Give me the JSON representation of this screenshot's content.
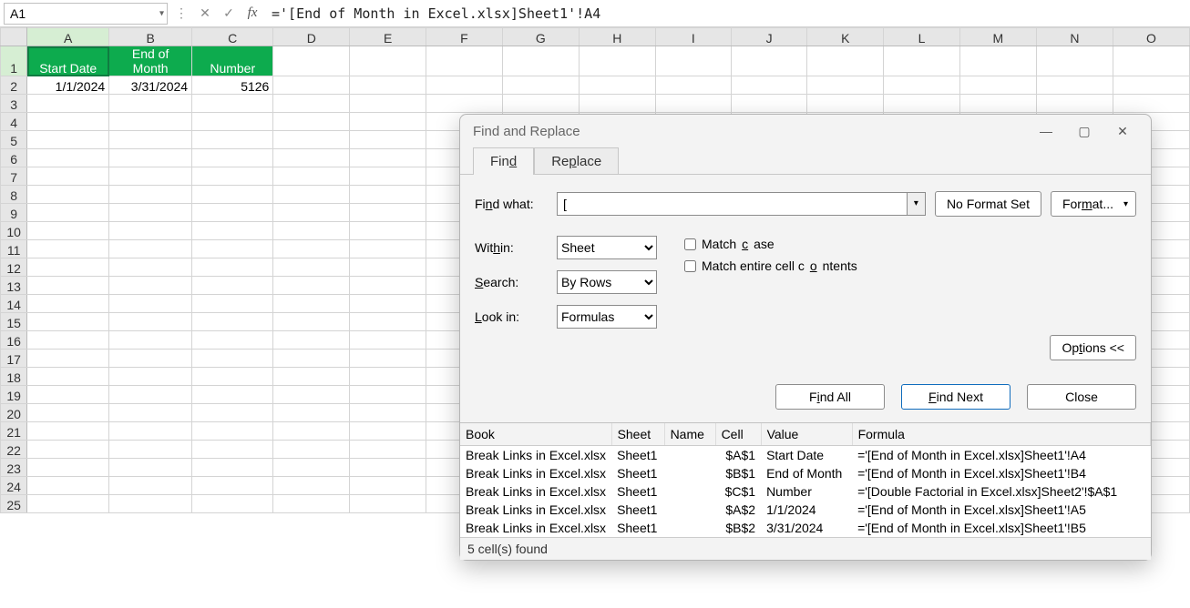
{
  "formula_bar": {
    "cell_ref": "A1",
    "formula": "='[End of Month in Excel.xlsx]Sheet1'!A4"
  },
  "columns": [
    "A",
    "B",
    "C",
    "D",
    "E",
    "F",
    "G",
    "H",
    "I",
    "J",
    "K",
    "L",
    "M",
    "N",
    "O"
  ],
  "rows": [
    "1",
    "2",
    "3",
    "4",
    "5",
    "6",
    "7",
    "8",
    "9",
    "10",
    "11",
    "12",
    "13",
    "14",
    "15",
    "16",
    "17",
    "18",
    "19",
    "20",
    "21",
    "22",
    "23",
    "24",
    "25"
  ],
  "data": {
    "A1": "Start Date",
    "B1": "End of Month",
    "C1": "Number",
    "A2": "1/1/2024",
    "B2": "3/31/2024",
    "C2": "5126"
  },
  "dialog": {
    "title": "Find and Replace",
    "tab_find": "Find",
    "tab_replace": "Replace",
    "find_what_label": "Find what:",
    "find_what_value": "[",
    "no_format": "No Format Set",
    "format_btn": "Format...",
    "within_label": "Within:",
    "within_value": "Sheet",
    "search_label": "Search:",
    "search_value": "By Rows",
    "lookin_label": "Look in:",
    "lookin_value": "Formulas",
    "match_case": "Match case",
    "match_entire": "Match entire cell contents",
    "options_btn": "Options <<",
    "find_all": "Find All",
    "find_next": "Find Next",
    "close": "Close",
    "headers": {
      "book": "Book",
      "sheet": "Sheet",
      "name": "Name",
      "cell": "Cell",
      "value": "Value",
      "formula": "Formula"
    },
    "results": [
      {
        "book": "Break Links in Excel.xlsx",
        "sheet": "Sheet1",
        "name": "",
        "cell": "$A$1",
        "value": "Start Date",
        "formula": "='[End of Month in Excel.xlsx]Sheet1'!A4"
      },
      {
        "book": "Break Links in Excel.xlsx",
        "sheet": "Sheet1",
        "name": "",
        "cell": "$B$1",
        "value": "End of Month",
        "formula": "='[End of Month in Excel.xlsx]Sheet1'!B4"
      },
      {
        "book": "Break Links in Excel.xlsx",
        "sheet": "Sheet1",
        "name": "",
        "cell": "$C$1",
        "value": "Number",
        "formula": "='[Double Factorial in Excel.xlsx]Sheet2'!$A$1"
      },
      {
        "book": "Break Links in Excel.xlsx",
        "sheet": "Sheet1",
        "name": "",
        "cell": "$A$2",
        "value": "1/1/2024",
        "formula": "='[End of Month in Excel.xlsx]Sheet1'!A5"
      },
      {
        "book": "Break Links in Excel.xlsx",
        "sheet": "Sheet1",
        "name": "",
        "cell": "$B$2",
        "value": "3/31/2024",
        "formula": "='[End of Month in Excel.xlsx]Sheet1'!B5"
      }
    ],
    "footer": "5 cell(s) found"
  }
}
